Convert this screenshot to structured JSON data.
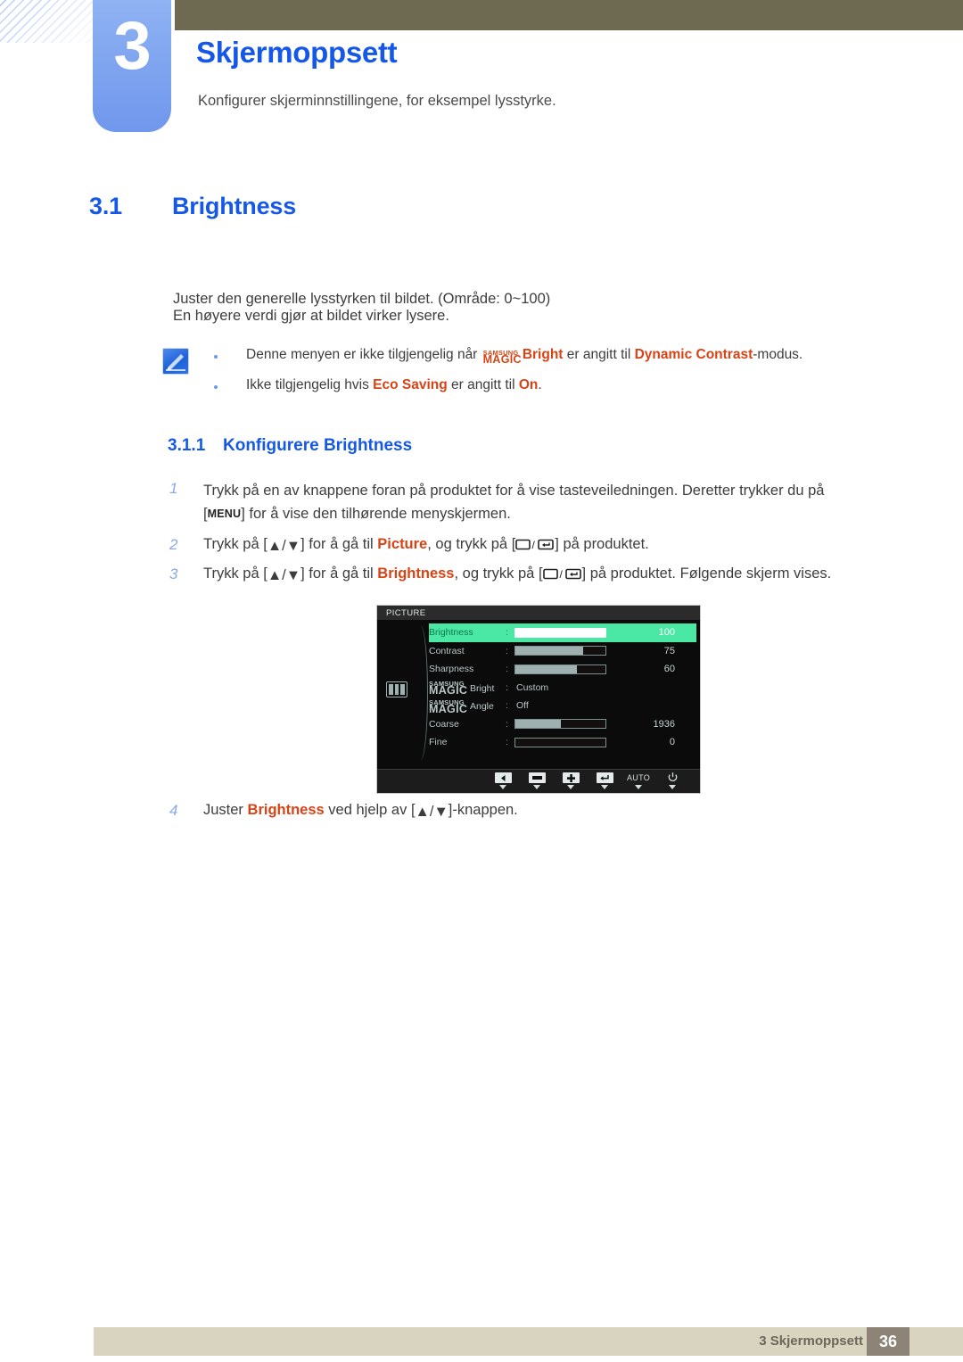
{
  "chapter": {
    "number": "3",
    "title": "Skjermoppsett",
    "subtitle": "Konfigurer skjerminnstillingene, for eksempel lysstyrke."
  },
  "section": {
    "number": "3.1",
    "title": "Brightness",
    "paragraph_1": "Juster den generelle lysstyrken til bildet. (Område: 0~100)",
    "paragraph_2": "En høyere verdi gjør at bildet virker lysere."
  },
  "note": {
    "icon": "note-pencil-icon",
    "items": [
      {
        "prefix": "Denne menyen er ikke tilgjengelig når ",
        "logo_top": "SAMSUNG",
        "logo_bottom": "MAGIC",
        "logo_suffix": "Bright",
        "middle": " er angitt til ",
        "highlight": "Dynamic Contrast",
        "suffix": "-modus."
      },
      {
        "prefix": "Ikke tilgjengelig hvis ",
        "highlight": "Eco Saving",
        "middle": " er angitt til ",
        "highlight2": "On",
        "suffix": "."
      }
    ]
  },
  "subsection": {
    "number": "3.1.1",
    "title": "Konfigurere Brightness"
  },
  "steps": [
    {
      "num": "1",
      "part_a": "Trykk på en av knappene foran på produktet for å vise tasteveiledningen. Deretter trykker du på",
      "bracket_open": "[",
      "key": "MENU",
      "bracket_close": "]",
      "part_b": "for å vise den tilhørende menyskjermen."
    },
    {
      "num": "2",
      "part_a": "Trykk på [",
      "keys": "▲/▼",
      "part_b": "] for å gå til ",
      "highlight": "Picture",
      "part_c": ", og trykk på [",
      "part_d": "] på produktet."
    },
    {
      "num": "3",
      "part_a": "Trykk på [",
      "keys": "▲/▼",
      "part_b": "] for å gå til ",
      "highlight": "Brightness",
      "part_c": ", og trykk på [",
      "part_d": "] på produktet. Følgende skjerm vises."
    },
    {
      "num": "4",
      "part_a": "Juster ",
      "highlight": "Brightness",
      "part_b": " ved hjelp av [",
      "keys": "▲/▼",
      "part_c": "]-knappen."
    }
  ],
  "osd": {
    "title": "PICTURE",
    "category_icon": "picture-category-icon",
    "rows": [
      {
        "label": "Brightness",
        "type": "bar",
        "value": "100",
        "fill": 100,
        "selected": true
      },
      {
        "label": "Contrast",
        "type": "bar",
        "value": "75",
        "fill": 75,
        "selected": false
      },
      {
        "label": "Sharpness",
        "type": "bar",
        "value": "60",
        "fill": 68,
        "selected": false
      },
      {
        "label_top": "SAMSUNG",
        "label_bottom": "MAGIC",
        "label_suffix": "Bright",
        "type": "text",
        "value": "Custom",
        "selected": false
      },
      {
        "label_top": "SAMSUNG",
        "label_bottom": "MAGIC",
        "label_suffix": "Angle",
        "type": "text",
        "value": "Off",
        "selected": false
      },
      {
        "label": "Coarse",
        "type": "bar",
        "value": "1936",
        "fill": 50,
        "selected": false
      },
      {
        "label": "Fine",
        "type": "bar",
        "value": "0",
        "fill": 0,
        "selected": false
      }
    ],
    "footer_keys": [
      {
        "name": "left-arrow-key",
        "glyph": "◀"
      },
      {
        "name": "minus-key",
        "glyph": "▬"
      },
      {
        "name": "plus-key",
        "glyph": "✚"
      },
      {
        "name": "enter-key",
        "glyph": "↵"
      },
      {
        "name": "auto-key",
        "text": "AUTO"
      },
      {
        "name": "power-key",
        "text": "⏻"
      }
    ]
  },
  "footer": {
    "text": "3 Skjermoppsett",
    "page": "36"
  },
  "colors": {
    "accent_blue": "#1558e8",
    "tab_blue": "#6f97ec",
    "olive": "#6e6a52",
    "highlight_orange": "#d84315",
    "osd_green": "#4ae8a4",
    "footer_beige": "#d8d4c0",
    "footer_page_bg": "#8d8377"
  }
}
